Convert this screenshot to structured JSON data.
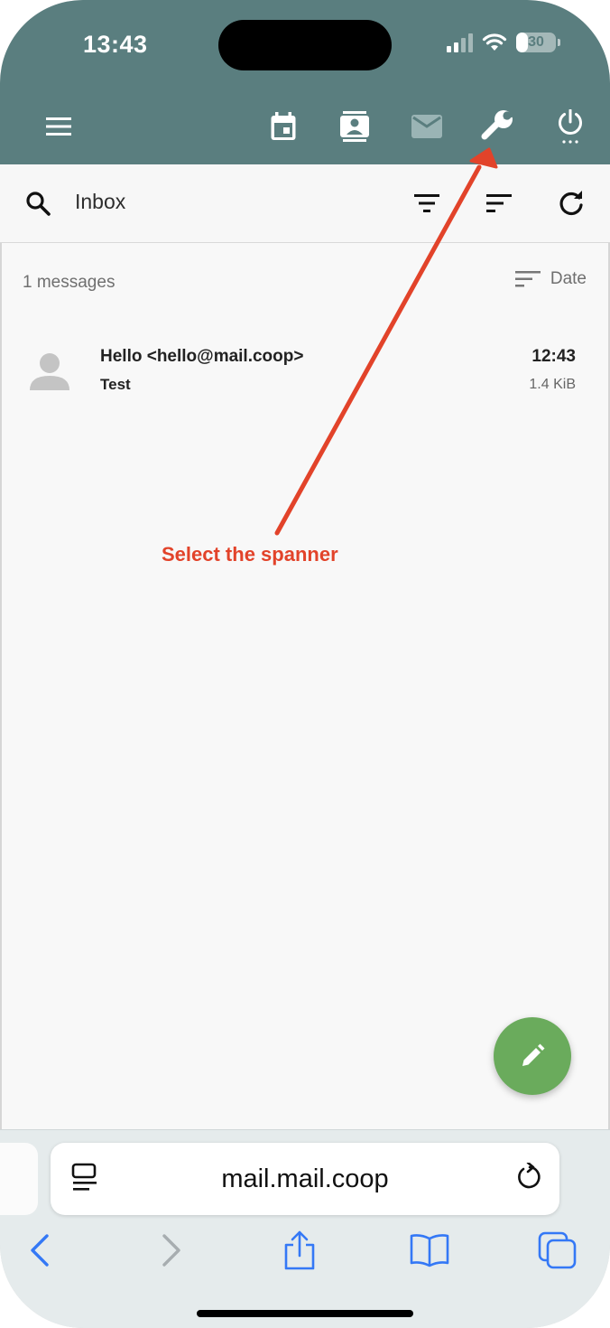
{
  "status_bar": {
    "time": "13:43",
    "battery": "30",
    "battery_level": 0.3
  },
  "header_icons": [
    "menu-icon",
    "calendar-icon",
    "contacts-icon",
    "mail-icon",
    "wrench-icon",
    "power-icon"
  ],
  "toolbar": {
    "folder": "Inbox",
    "icons": [
      "search-icon",
      "filter-icon",
      "sort-icon",
      "refresh-icon"
    ]
  },
  "list": {
    "count": "1 messages",
    "sort_label": "Date",
    "messages": [
      {
        "from": "Hello <hello@mail.coop>",
        "subject": "Test",
        "time": "12:43",
        "size": "1.4 KiB"
      }
    ]
  },
  "annotation": {
    "text": "Select the spanner",
    "color": "#e2432a"
  },
  "browser": {
    "url": "mail.mail.coop",
    "nav_icons": [
      "back-icon",
      "forward-icon",
      "share-icon",
      "bookmarks-icon",
      "tabs-icon"
    ]
  },
  "colors": {
    "header": "#5a7e7f",
    "fab": "#6aab5c",
    "safari_blue": "#3478f6"
  }
}
